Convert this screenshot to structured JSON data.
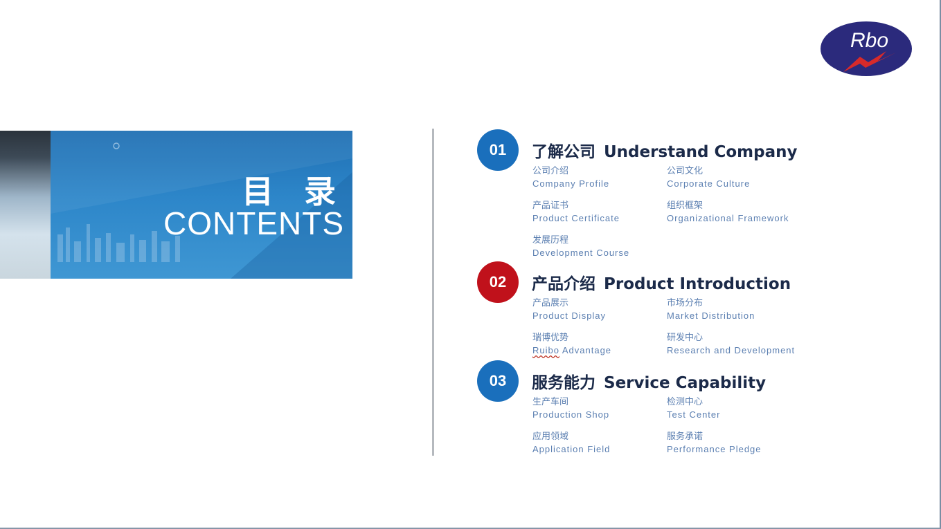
{
  "logo": {
    "text": "Rbo",
    "colors": {
      "oval": "#2b2a7c",
      "bolt": "#d72a2a"
    }
  },
  "banner": {
    "title_cn": "目 录",
    "title_en": "CONTENTS"
  },
  "colors": {
    "blue_circle": "#1a6fbc",
    "red_circle": "#c0111b",
    "heading": "#1b2a49",
    "item": "#5b7fb1"
  },
  "sections": [
    {
      "num": "01",
      "title_cn": "了解公司",
      "title_en": "Understand Company",
      "items": [
        {
          "cn": "公司介绍",
          "en": "Company Profile"
        },
        {
          "cn": "公司文化",
          "en": "Corporate Culture"
        },
        {
          "cn": "产品证书",
          "en": "Product Certificate"
        },
        {
          "cn": "组织框架",
          "en": "Organizational Framework"
        },
        {
          "cn": "发展历程",
          "en": "Development Course"
        }
      ]
    },
    {
      "num": "02",
      "title_cn": "产品介绍",
      "title_en": "Product Introduction",
      "items": [
        {
          "cn": "产品展示",
          "en": "Product Display"
        },
        {
          "cn": "市场分布",
          "en": "Market Distribution"
        },
        {
          "cn": "瑞博优势",
          "en_a": "Ruibo",
          "en_b": " Advantage"
        },
        {
          "cn": "研发中心",
          "en": "Research and Development"
        }
      ]
    },
    {
      "num": "03",
      "title_cn": "服务能力",
      "title_en": "Service Capability",
      "items": [
        {
          "cn": "生产车间",
          "en": "Production Shop"
        },
        {
          "cn": "检测中心",
          "en": "Test Center"
        },
        {
          "cn": "应用领域",
          "en": "Application Field"
        },
        {
          "cn": "服务承诺",
          "en": "Performance Pledge"
        }
      ]
    }
  ]
}
